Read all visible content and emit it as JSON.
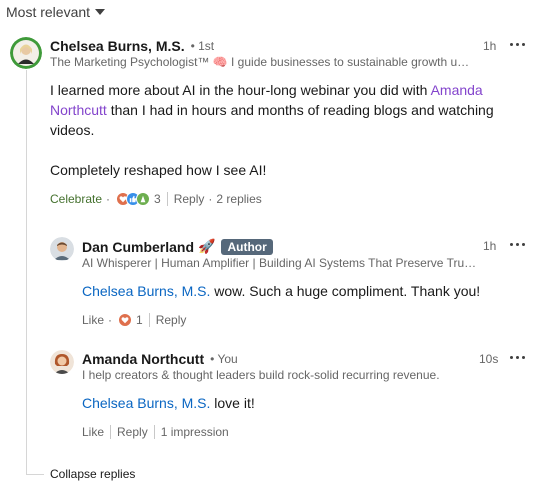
{
  "sort": {
    "label": "Most relevant"
  },
  "comment": {
    "author": "Chelsea Burns, M.S.",
    "degree": "• 1st",
    "headline": "The Marketing Psychologist™ 🧠 I guide businesses to sustainable growth us…",
    "time": "1h",
    "text_part1": "I learned more about AI in the hour-long webinar you did with ",
    "mention": "Amanda Northcutt",
    "text_part2": " than I had in hours and months of reading blogs and watching videos.",
    "text_para2": "Completely reshaped how I see AI!",
    "reaction_label": "Celebrate",
    "reaction_count": "3",
    "reply_label": "Reply",
    "replies_count": "2 replies"
  },
  "replies": [
    {
      "author": "Dan Cumberland",
      "emoji": "🚀",
      "badge": "Author",
      "headline": "AI Whisperer | Human Amplifier | Building AI Systems That Preserve Tru…",
      "time": "1h",
      "mention": "Chelsea Burns, M.S.",
      "text": " wow. Such a huge compliment. Thank you!",
      "like_label": "Like",
      "reaction_count": "1",
      "reply_label": "Reply"
    },
    {
      "author": "Amanda Northcutt",
      "meta": "• You",
      "headline": "I help creators & thought leaders build rock-solid recurring revenue.",
      "time": "10s",
      "mention": "Chelsea Burns, M.S.",
      "text": " love it!",
      "like_label": "Like",
      "reply_label": "Reply",
      "impressions": "1 impression"
    }
  ],
  "collapse_label": "Collapse replies",
  "colors": {
    "celebrate": "#44712e",
    "mention_purple": "#8344cc",
    "mention_blue": "#0a66c2",
    "badge": "#56687a"
  }
}
